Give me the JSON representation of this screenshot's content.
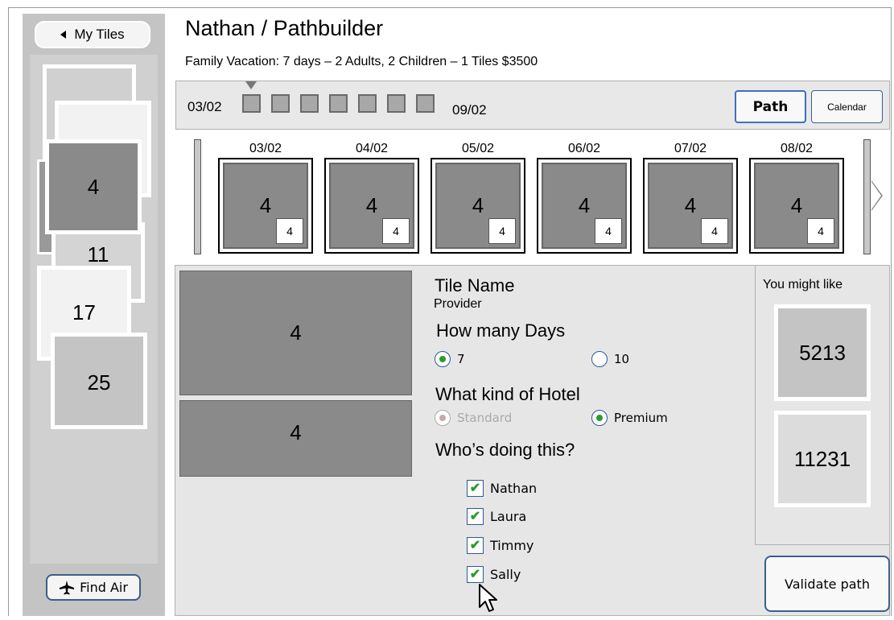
{
  "sidebar": {
    "my_tiles_label": "My Tiles",
    "find_air_label": "Find Air",
    "tiles": [
      {
        "label": ""
      },
      {
        "label": ""
      },
      {
        "label": "4"
      },
      {
        "label": "11"
      },
      {
        "label": "17"
      },
      {
        "label": "25"
      }
    ]
  },
  "header": {
    "title": "Nathan / Pathbuilder",
    "subtitle": "Family Vacation:  7 days – 2 Adults, 2 Children – 1 Tiles $3500"
  },
  "timeline": {
    "start_date": "03/02",
    "end_date": "09/02",
    "day_count": 7,
    "path_label": "Path",
    "calendar_label": "Calendar"
  },
  "days": [
    {
      "date": "03/02",
      "tile": "4",
      "badge": "4"
    },
    {
      "date": "04/02",
      "tile": "4",
      "badge": "4"
    },
    {
      "date": "05/02",
      "tile": "4",
      "badge": "4"
    },
    {
      "date": "06/02",
      "tile": "4",
      "badge": "4"
    },
    {
      "date": "07/02",
      "tile": "4",
      "badge": "4"
    },
    {
      "date": "08/02",
      "tile": "4",
      "badge": "4"
    }
  ],
  "detail": {
    "image_top": "4",
    "image_bottom": "4",
    "tile_name": "Tile Name",
    "provider": "Provider",
    "days_question": "How many Days",
    "days_options": [
      {
        "label": "7",
        "selected": true
      },
      {
        "label": "10",
        "selected": false
      }
    ],
    "hotel_question": "What kind of Hotel",
    "hotel_options": [
      {
        "label": "Standard",
        "selected": true,
        "disabled": true
      },
      {
        "label": "Premium",
        "selected": true,
        "disabled": false
      }
    ],
    "who_question": "Who’s doing this?",
    "people": [
      {
        "name": "Nathan",
        "checked": true
      },
      {
        "name": "Laura",
        "checked": true
      },
      {
        "name": "Timmy",
        "checked": true
      },
      {
        "name": "Sally",
        "checked": true
      }
    ]
  },
  "suggestions": {
    "title": "You might like",
    "items": [
      {
        "label": "5213"
      },
      {
        "label": "11231"
      }
    ]
  },
  "validate_label": "Validate path",
  "icons": {
    "back": "triangle-left-icon",
    "plane": "airplane-icon",
    "check": "checkmark-icon",
    "cursor": "mouse-cursor-icon"
  }
}
